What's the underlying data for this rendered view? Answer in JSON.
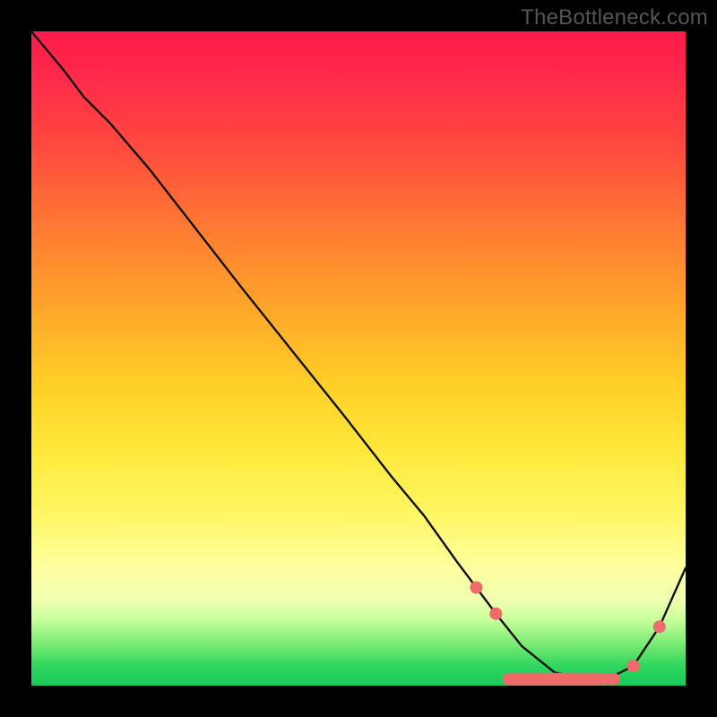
{
  "watermark": "TheBottleneck.com",
  "chart_data": {
    "type": "line",
    "title": "",
    "xlabel": "",
    "ylabel": "",
    "xlim": [
      0,
      100
    ],
    "ylim": [
      0,
      100
    ],
    "grid": false,
    "series": [
      {
        "name": "bottleneck-curve",
        "x": [
          0,
          5,
          8,
          12,
          18,
          25,
          32,
          40,
          48,
          55,
          60,
          65,
          68,
          71,
          75,
          80,
          85,
          88,
          92,
          96,
          100
        ],
        "y": [
          100,
          94,
          90,
          86,
          79,
          70,
          61,
          51,
          41,
          32,
          26,
          19,
          15,
          11,
          6,
          2,
          1,
          1,
          3,
          9,
          18
        ]
      }
    ],
    "markers": {
      "name": "highlight-points-near-minimum",
      "x": [
        68,
        71,
        88,
        89,
        92,
        96
      ],
      "y": [
        15,
        11,
        1,
        1,
        3,
        9
      ]
    },
    "marker_bar": {
      "name": "flat-minimum-segment",
      "x_start": 72,
      "x_end": 88,
      "y": 1
    },
    "background_gradient": {
      "description": "vertical red-to-green bottleneck gradient",
      "stops": [
        {
          "pos": 0.0,
          "hex": "#ff1a4a"
        },
        {
          "pos": 0.3,
          "hex": "#ff7a33"
        },
        {
          "pos": 0.55,
          "hex": "#ffcf27"
        },
        {
          "pos": 0.82,
          "hex": "#feffa0"
        },
        {
          "pos": 1.0,
          "hex": "#18c95a"
        }
      ]
    }
  }
}
